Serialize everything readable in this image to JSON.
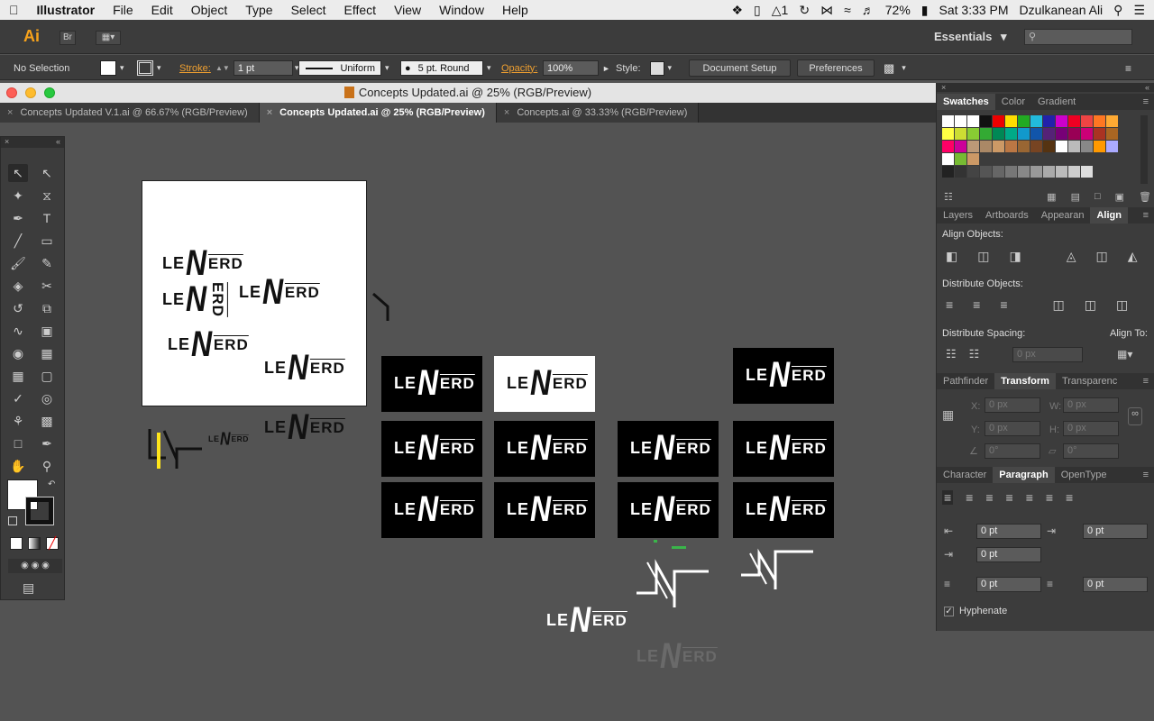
{
  "menubar": {
    "app": "Illustrator",
    "items": [
      "File",
      "Edit",
      "Object",
      "Type",
      "Select",
      "Effect",
      "View",
      "Window",
      "Help"
    ],
    "status": {
      "adobe_count": "1",
      "battery": "72%",
      "clock": "Sat 3:33 PM",
      "user": "Dzulkanean Ali"
    }
  },
  "appbar": {
    "logo": "Ai",
    "bridge": "Br",
    "workspace": "Essentials"
  },
  "control": {
    "selection": "No Selection",
    "stroke_label": "Stroke:",
    "stroke_value": "1 pt",
    "profile": "Uniform",
    "brush": "5 pt. Round",
    "opacity_label": "Opacity:",
    "opacity_value": "100%",
    "style_label": "Style:",
    "doc_setup": "Document Setup",
    "preferences": "Preferences"
  },
  "document": {
    "title": "Concepts Updated.ai @ 25% (RGB/Preview)",
    "tabs": [
      {
        "label": "Concepts Updated V.1.ai @ 66.67% (RGB/Preview)",
        "active": false
      },
      {
        "label": "Concepts Updated.ai @ 25% (RGB/Preview)",
        "active": true
      },
      {
        "label": "Concepts.ai @ 33.33% (RGB/Preview)",
        "active": false
      }
    ]
  },
  "artwork": {
    "le": "LE",
    "erd": "ERD",
    "n": "N"
  },
  "panels": {
    "swatches_tabs": [
      "Swatches",
      "Color",
      "Gradient"
    ],
    "align_tabs": [
      "Layers",
      "Artboards",
      "Appearan",
      "Align"
    ],
    "align_objects": "Align Objects:",
    "distribute_objects": "Distribute Objects:",
    "distribute_spacing": "Distribute Spacing:",
    "align_to": "Align To:",
    "spacing_value": "0 px",
    "transform_tabs": [
      "Pathfinder",
      "Transform",
      "Transparenc"
    ],
    "transform": {
      "x_label": "X:",
      "y_label": "Y:",
      "w_label": "W:",
      "h_label": "H:",
      "x": "0 px",
      "y": "0 px",
      "w": "0 px",
      "h": "0 px",
      "angle": "0°",
      "shear": "0°"
    },
    "paragraph_tabs": [
      "Character",
      "Paragraph",
      "OpenType"
    ],
    "paragraph": {
      "left_indent": "0 pt",
      "right_indent": "0 pt",
      "first_line": "0 pt",
      "space_before": "0 pt",
      "space_after": "0 pt",
      "hyphenate": "Hyphenate"
    }
  }
}
